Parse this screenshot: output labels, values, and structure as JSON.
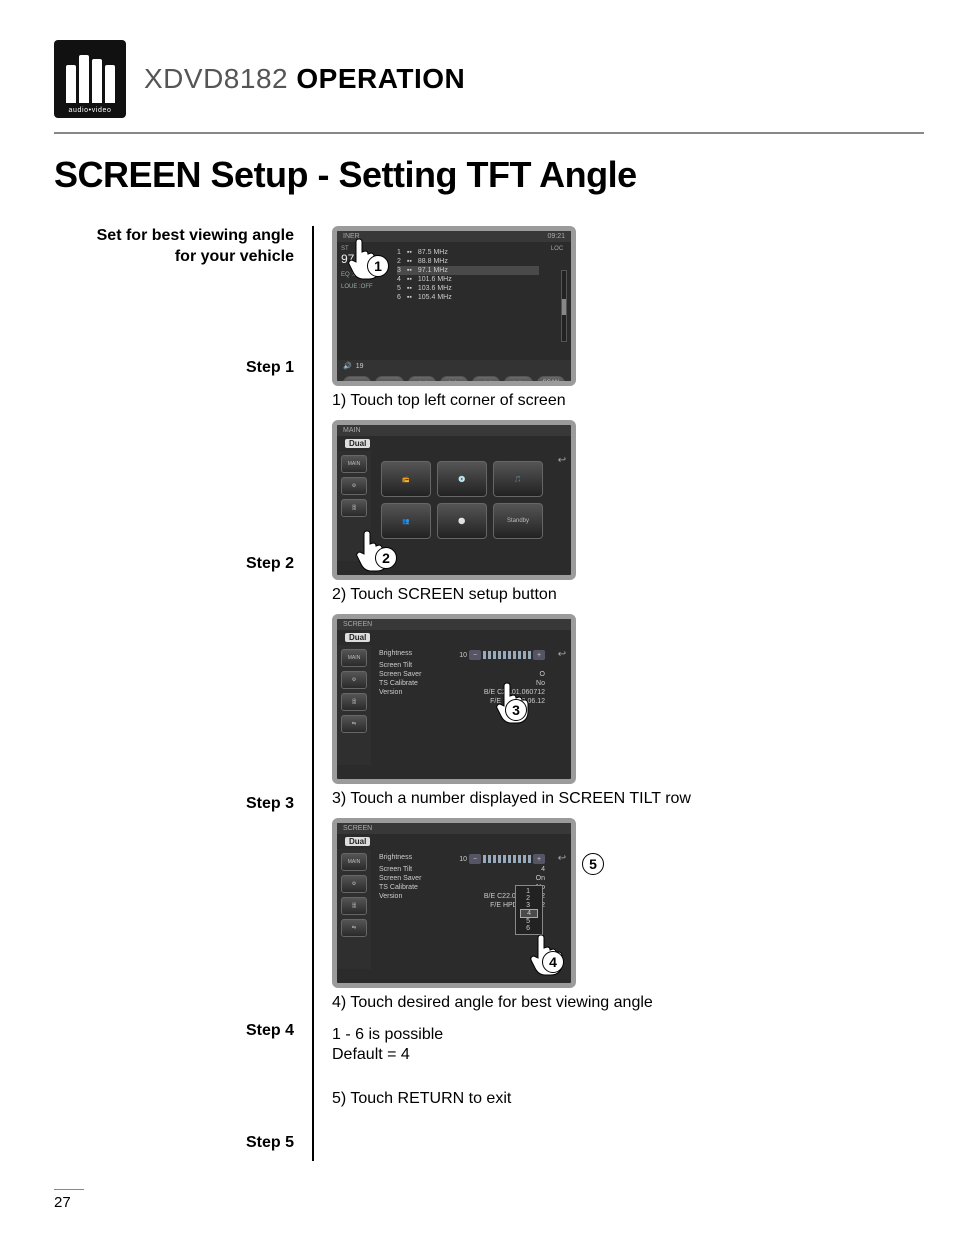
{
  "header": {
    "logo_subtext": "audio•video",
    "model": "XDVD8182",
    "op": "OPERATION"
  },
  "title": "SCREEN Setup - Setting TFT Angle",
  "intro": "Set for best viewing angle for your vehicle",
  "steps": {
    "s1": "Step 1",
    "s2": "Step 2",
    "s3": "Step 3",
    "s4": "Step 4",
    "s5": "Step 5"
  },
  "captions": {
    "c1": "1) Touch top left corner of screen",
    "c2": "2) Touch SCREEN setup button",
    "c3": "3) Touch a number displayed in SCREEN TILT row",
    "c4": "4) Touch desired angle for best viewing angle",
    "c5_note1": "1 - 6  is possible",
    "c5_note2": "Default = 4",
    "c5": "5) Touch RETURN to exit"
  },
  "callouts": {
    "n1": "1",
    "n2": "2",
    "n3": "3",
    "n4": "4",
    "n5": "5"
  },
  "shot1": {
    "top_label": "INER",
    "clock": "09:21",
    "band": "ST",
    "freq": "97.",
    "presets": [
      {
        "n": "1",
        "icon": "",
        "mhz": "87.5 MHz"
      },
      {
        "n": "2",
        "icon": "",
        "mhz": "88.8 MHz"
      },
      {
        "n": "3",
        "icon": "",
        "mhz": "97.1 MHz"
      },
      {
        "n": "4",
        "icon": "",
        "mhz": "101.6 MHz"
      },
      {
        "n": "5",
        "icon": "",
        "mhz": "103.6 MHz"
      },
      {
        "n": "6",
        "icon": "",
        "mhz": "105.4 MHz"
      }
    ],
    "eq": "EQ    :USER",
    "loud": "LOUE :OFF",
    "vol_label": "19",
    "loc": "LOC",
    "buttons": [
      "",
      "",
      "◄◄",
      "►►",
      "◄◄",
      "►►",
      "SCAN"
    ]
  },
  "shot2": {
    "top_label": "MAIN",
    "brand": "Dual",
    "side": [
      "MAIN",
      "",
      "",
      ""
    ],
    "cells": [
      "",
      "",
      "",
      "",
      "",
      "Standby"
    ]
  },
  "shot3": {
    "top_label": "SCREEN",
    "brand": "Dual",
    "side": [
      "MAIN",
      "",
      "",
      "",
      ""
    ],
    "rows": {
      "brightness_label": "Brightness",
      "brightness_val": "10",
      "tilt_label": "Screen Tilt",
      "tilt_val": "",
      "saver_label": "Screen Saver",
      "saver_val": "O",
      "cal_label": "TS Calibrate",
      "cal_val": "No",
      "ver_label": "Version",
      "ver_be": "B/E C22.01.060712",
      "ver_fe": "F/E HPD60.06.12"
    }
  },
  "shot4": {
    "top_label": "SCREEN",
    "brand": "Dual",
    "side": [
      "MAIN",
      "",
      "",
      "",
      ""
    ],
    "rows": {
      "brightness_label": "Brightness",
      "brightness_val": "10",
      "tilt_label": "Screen Tilt",
      "tilt_val": "4",
      "saver_label": "Screen Saver",
      "saver_val": "On",
      "cal_label": "TS Calibrate",
      "cal_val": "No",
      "ver_label": "Version",
      "ver_be": "B/E C22.01.060712",
      "ver_fe": "F/E HPD60.06.12"
    },
    "dropdown": [
      "1",
      "2",
      "3",
      "4",
      "5",
      "6"
    ]
  },
  "page_number": "27"
}
